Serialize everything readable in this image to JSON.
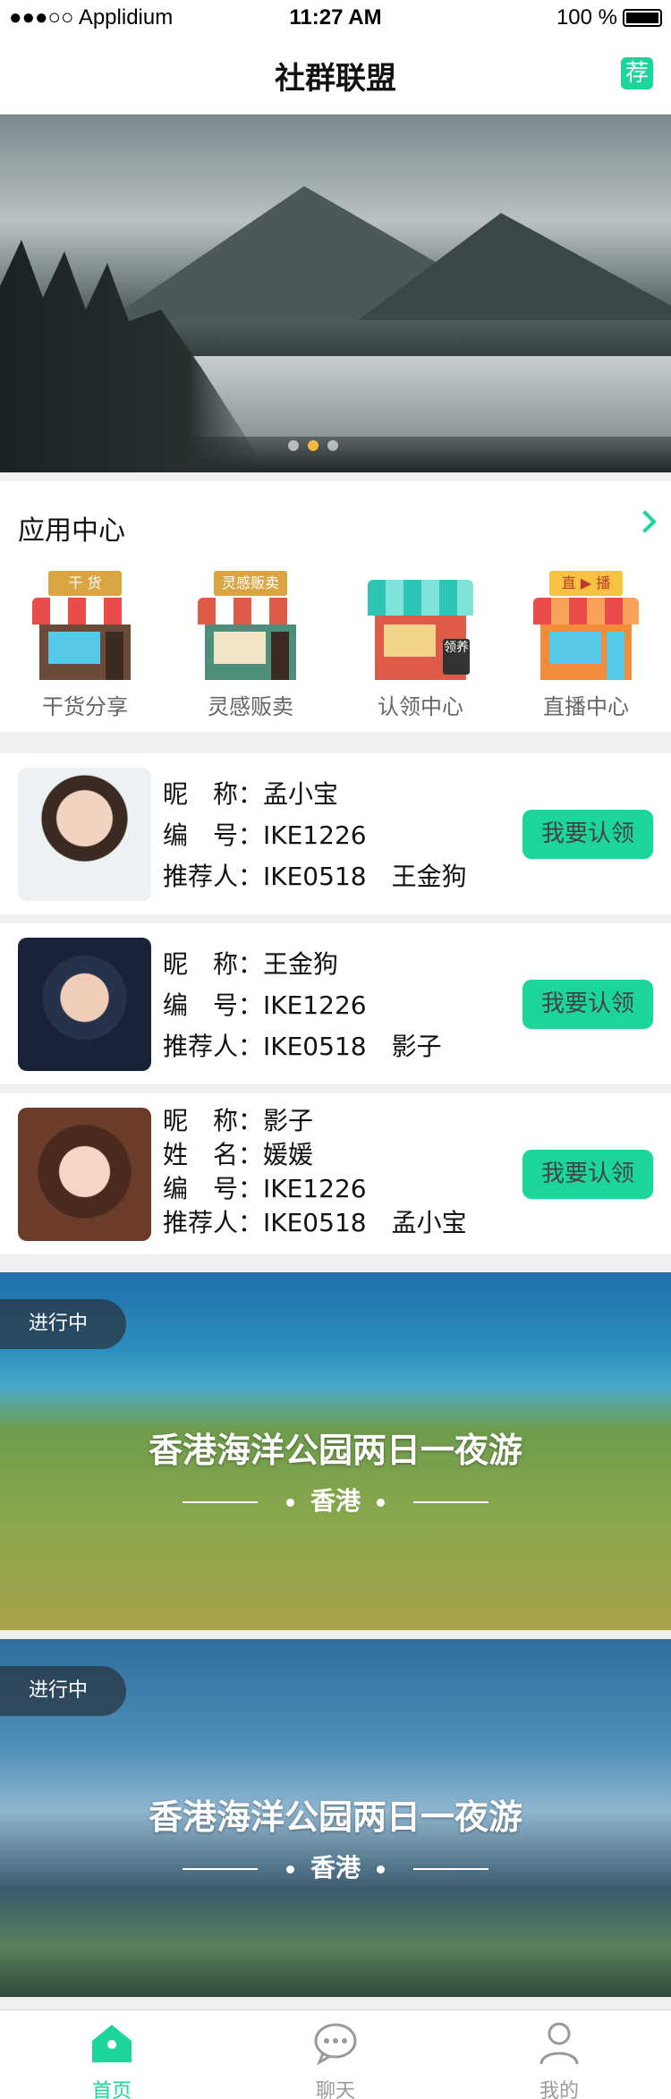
{
  "status_bar": {
    "carrier": "●●●○○ Applidium",
    "time": "11:27 AM",
    "battery": "100 %"
  },
  "nav": {
    "title": "社群联盟",
    "recommend_button": "荐"
  },
  "app_center": {
    "heading": "应用中心",
    "items": [
      {
        "label": "干货分享",
        "sign": "干 货",
        "sign_color": "#d9a441"
      },
      {
        "label": "灵感贩卖",
        "sign": "灵感贩卖",
        "sign_color": "#d9a441"
      },
      {
        "label": "认领中心",
        "sign": "领养",
        "sign_color": "#333333"
      },
      {
        "label": "直播中心",
        "sign": "直 ▶ 播",
        "sign_color": "#f5c242"
      }
    ]
  },
  "members": [
    {
      "rows": [
        "昵　称：孟小宝",
        "编　号：IKE1226",
        "推荐人：IKE0518　王金狗"
      ],
      "button": "我要认领"
    },
    {
      "rows": [
        "昵　称：王金狗",
        "编　号：IKE1226",
        "推荐人：IKE0518　影子"
      ],
      "button": "我要认领"
    },
    {
      "rows": [
        "昵　称：影子",
        "姓　名：媛媛",
        "编　号：IKE1226",
        "推荐人：IKE0518　孟小宝"
      ],
      "button": "我要认领"
    }
  ],
  "activities": [
    {
      "status": "进行中",
      "title": "香港海洋公园两日一夜游",
      "location": "香港"
    },
    {
      "status": "进行中",
      "title": "香港海洋公园两日一夜游",
      "location": "香港"
    }
  ],
  "tabbar": {
    "home": "首页",
    "chat": "聊天",
    "mine": "我的"
  },
  "colors": {
    "accent": "#1bd59b",
    "text": "#121212",
    "secondary": "#666666"
  }
}
